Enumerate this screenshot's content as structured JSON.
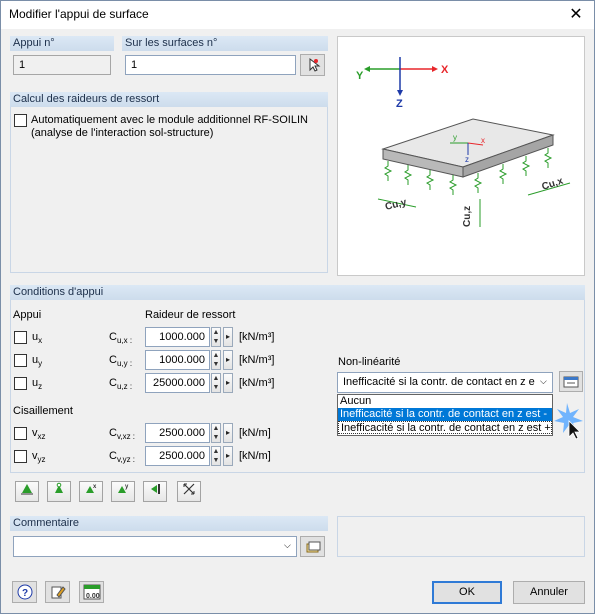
{
  "window": {
    "title": "Modifier l'appui de surface",
    "close": "✕"
  },
  "appui": {
    "label": "Appui n°",
    "value": "1"
  },
  "surfaces": {
    "label": "Sur les surfaces n°",
    "value": "1"
  },
  "calcul": {
    "header": "Calcul des raideurs de ressort",
    "checkbox_label_line1": "Automatiquement avec le module additionnel RF-SOILIN",
    "checkbox_label_line2": "(analyse de l'interaction sol-structure)"
  },
  "conditions": {
    "header": "Conditions d'appui",
    "col_appui": "Appui",
    "col_raideur": "Raideur de ressort",
    "rows": [
      {
        "name": "ux",
        "sym": "u",
        "sub": "x",
        "csym": "C",
        "csub": "u,x :",
        "value": "1000.000",
        "unit": "[kN/m³]"
      },
      {
        "name": "uy",
        "sym": "u",
        "sub": "y",
        "csym": "C",
        "csub": "u,y :",
        "value": "1000.000",
        "unit": "[kN/m³]"
      },
      {
        "name": "uz",
        "sym": "u",
        "sub": "z",
        "csym": "C",
        "csub": "u,z :",
        "value": "25000.000",
        "unit": "[kN/m³]"
      }
    ],
    "cisaillement": "Cisaillement",
    "shear_rows": [
      {
        "name": "vxz",
        "sym": "v",
        "sub": "xz",
        "csym": "C",
        "csub": "v,xz :",
        "value": "2500.000",
        "unit": "[kN/m]"
      },
      {
        "name": "vyz",
        "sym": "v",
        "sub": "yz",
        "csym": "C",
        "csub": "v,yz :",
        "value": "2500.000",
        "unit": "[kN/m]"
      }
    ],
    "nonlin_label": "Non-linéarité",
    "nonlin_value": "Inefficacité si la contr. de contact en z e",
    "dropdown_options": [
      "Aucun",
      "Inefficacité si la contr. de contact en z est -",
      "Inefficacité si la contr. de contact en z est +"
    ]
  },
  "comment": {
    "header": "Commentaire",
    "value": ""
  },
  "buttons": {
    "ok": "OK",
    "cancel": "Annuler"
  },
  "diagram": {
    "axis_y": "Y",
    "axis_x": "X",
    "axis_z": "Z",
    "small_y": "y",
    "small_x": "x",
    "small_z": "z",
    "label_cuy": "Cu,y",
    "label_cux": "Cu,x",
    "label_cuz": "Cu,z"
  },
  "colors": {
    "accent": "#0078d7",
    "axis_red": "#e8262b",
    "axis_green": "#2a9d2a",
    "axis_blue": "#1e3aa8"
  }
}
